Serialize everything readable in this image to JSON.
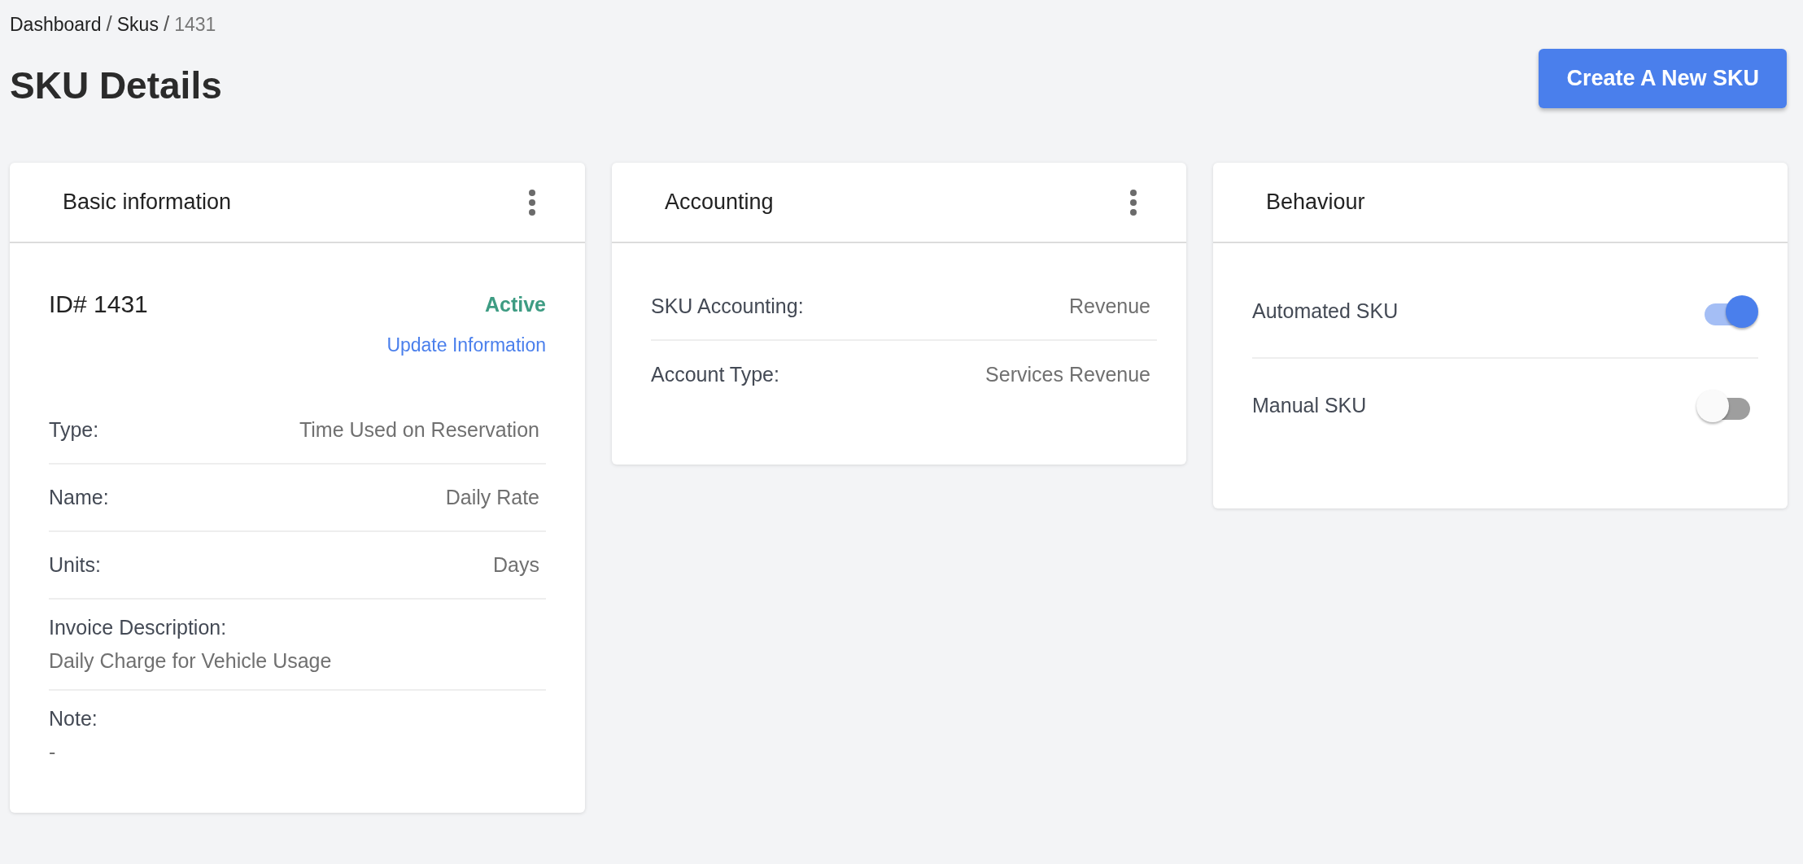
{
  "breadcrumb": [
    {
      "label": "Dashboard",
      "current": false
    },
    {
      "label": "Skus",
      "current": false,
      "separator": "/"
    },
    {
      "label": "1431",
      "current": true,
      "separator": "/"
    }
  ],
  "title": "SKU Details",
  "create_button": "Create A New SKU",
  "cards": [
    {
      "kind": "details",
      "title": "Basic information",
      "menu": true,
      "id_label": "ID# 1431",
      "status": "Active",
      "update_link": "Update Information",
      "fields": [
        {
          "kind": "inline",
          "label": "Type:",
          "value": "Time Used on Reservation"
        },
        {
          "kind": "inline",
          "label": "Name:",
          "value": "Daily Rate"
        },
        {
          "kind": "inline",
          "label": "Units:",
          "value": "Days"
        },
        {
          "kind": "stacked",
          "label": "Invoice Description:",
          "value": "Daily Charge for Vehicle Usage"
        },
        {
          "kind": "stacked",
          "label": "Note:",
          "value": "-"
        }
      ]
    },
    {
      "kind": "fields",
      "title": "Accounting",
      "menu": true,
      "fields": [
        {
          "kind": "inline",
          "label": "SKU Accounting:",
          "value": "Revenue"
        },
        {
          "kind": "inline",
          "label": "Account Type:",
          "value": "Services Revenue"
        }
      ]
    },
    {
      "kind": "toggles",
      "title": "Behaviour",
      "menu": false,
      "toggles": [
        {
          "label": "Automated SKU",
          "on": true
        },
        {
          "label": "Manual SKU",
          "on": false
        }
      ]
    }
  ]
}
